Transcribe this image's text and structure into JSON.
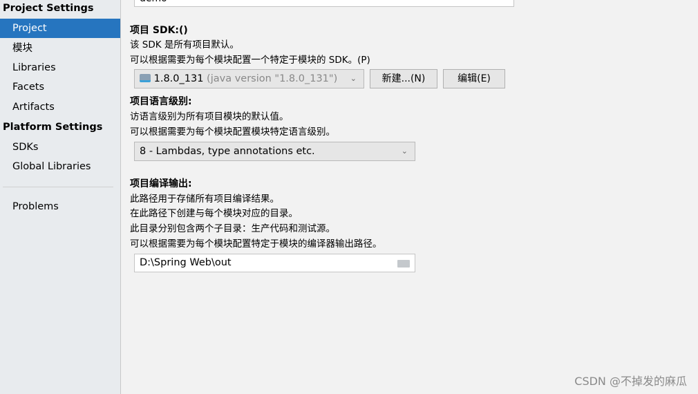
{
  "sidebar": {
    "project_settings": "Project Settings",
    "items": [
      "Project",
      "模块",
      "Libraries",
      "Facets",
      "Artifacts"
    ],
    "platform_settings": "Platform Settings",
    "platform_items": [
      "SDKs",
      "Global Libraries"
    ],
    "problems": "Problems",
    "selected": "Project"
  },
  "name_field": {
    "value": "demo"
  },
  "sdk": {
    "title": "项目 SDK:()",
    "desc1": "该 SDK 是所有项目默认。",
    "desc2": "可以根据需要为每个模块配置一个特定于模块的 SDK。(P)",
    "version": "1.8.0_131",
    "detail": "(java version \"1.8.0_131\")",
    "new_button": "新建...(N)",
    "edit_button": "编辑(E)"
  },
  "language": {
    "title": "项目语言级别:",
    "desc1": "访语言级别为所有项目模块的默认值。",
    "desc2": "可以根据需要为每个模块配置模块特定语言级别。",
    "value": "8 - Lambdas, type annotations etc."
  },
  "output": {
    "title": "项目编译输出:",
    "desc1": "此路径用于存储所有项目编译结果。",
    "desc2": "在此路径下创建与每个模块对应的目录。",
    "desc3": "此目录分别包含两个子目录：生产代码和测试源。",
    "desc4": "可以根据需要为每个模块配置特定于模块的编译器输出路径。",
    "path": "D:\\Spring Web\\out"
  },
  "watermark": "CSDN @不掉发的麻瓜"
}
